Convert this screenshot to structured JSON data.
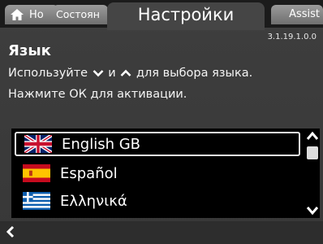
{
  "tabs": {
    "home_label": "Но",
    "status_label": "Состоян",
    "settings_label": "Настройки",
    "assist_label": "Assist"
  },
  "version": "3.1.19.1.0.0",
  "page": {
    "title": "Язык",
    "instruction_part1": "Используйте",
    "instruction_and": "и",
    "instruction_part2": "для выбора языка.",
    "instruction_line2": "Нажмите ОК для активации."
  },
  "languages": [
    {
      "label": "English GB",
      "flag": "uk-flag-icon",
      "selected": true
    },
    {
      "label": "Español",
      "flag": "spain-flag-icon",
      "selected": false
    },
    {
      "label": "Ελληνικά",
      "flag": "greece-flag-icon",
      "selected": false
    }
  ],
  "colors": {
    "background": "#3d3d3d",
    "list_background": "#000000",
    "tab_inactive": "#8a8a8a",
    "tab_active": "#454545",
    "selection_border": "#e8e8e8"
  }
}
